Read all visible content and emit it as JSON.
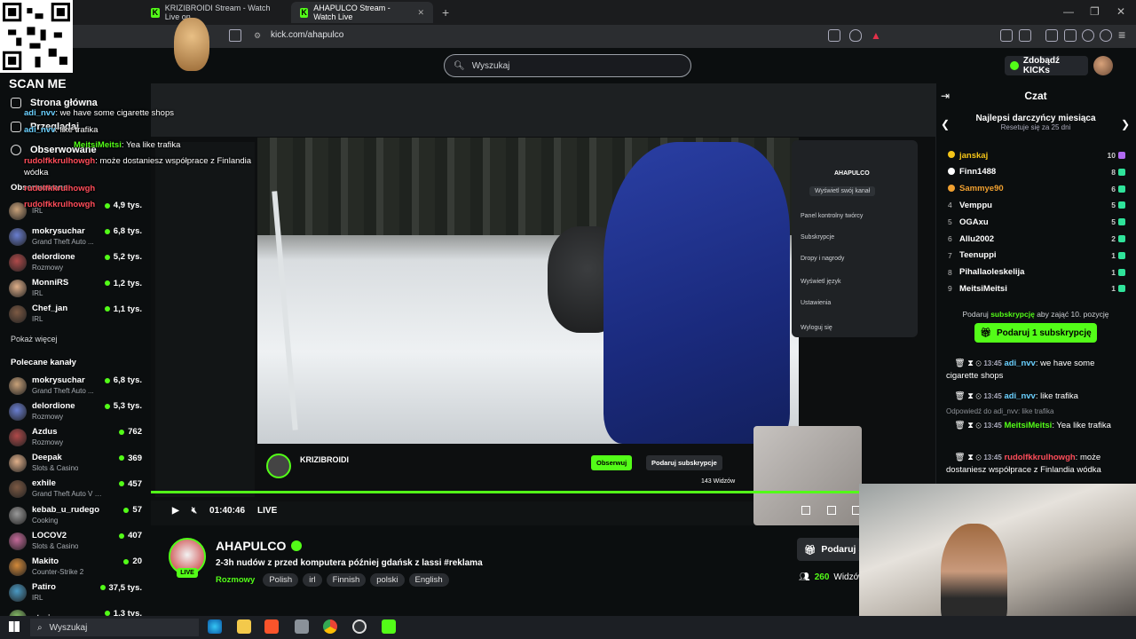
{
  "browser": {
    "tabs": [
      {
        "label": "KRIZIBROIDI Stream - Watch Live on",
        "active": false
      },
      {
        "label": "AHAPULCO Stream - Watch Live",
        "active": true
      }
    ],
    "url": "kick.com/ahapulco",
    "new_tab_symbol": "+"
  },
  "header": {
    "search_placeholder": "Wyszukaj",
    "kicks_button": "Zdobądź KICKs"
  },
  "overlay": {
    "scan_me": "SCAN ME",
    "chat_lines": [
      {
        "user": "adi_nvv",
        "text": "we have some cigarette shops"
      },
      {
        "user": "adi_nvv",
        "text": "like trafika"
      },
      {
        "user": "MeitsiMeitsi",
        "text": "Yea like trafika"
      },
      {
        "user": "rudolfkkrulhowgh",
        "text": "może dostaniesz współprace z Finlandia"
      },
      {
        "user": "",
        "text": "wódka"
      },
      {
        "user": "rudolfkkrulhowgh",
        "text": ""
      },
      {
        "user": "rudolfkkrulhowgh",
        "text": ""
      }
    ]
  },
  "sidebar": {
    "nav": [
      "Strona główna",
      "Przeglądaj",
      "Obserwowane"
    ],
    "followed_title": "Obserwowane",
    "followed": [
      {
        "name": "",
        "category": "IRL",
        "viewers": "4,9 tys."
      },
      {
        "name": "mokrysuchar",
        "category": "Grand Theft Auto ...",
        "viewers": "6,8 tys."
      },
      {
        "name": "delordione",
        "category": "Rozmowy",
        "viewers": "5,2 tys."
      },
      {
        "name": "MonniRS",
        "category": "IRL",
        "viewers": "1,2 tys."
      },
      {
        "name": "Chef_jan",
        "category": "IRL",
        "viewers": "1,1 tys."
      }
    ],
    "show_more": "Pokaż więcej",
    "recommended_title": "Polecane kanały",
    "recommended": [
      {
        "name": "mokrysuchar",
        "category": "Grand Theft Auto ...",
        "viewers": "6,8 tys."
      },
      {
        "name": "delordione",
        "category": "Rozmowy",
        "viewers": "5,3 tys."
      },
      {
        "name": "Azdus",
        "category": "Rozmowy",
        "viewers": "762"
      },
      {
        "name": "Deepak",
        "category": "Slots & Casino",
        "viewers": "369"
      },
      {
        "name": "exhile",
        "category": "Grand Theft Auto V (G...",
        "viewers": "457"
      },
      {
        "name": "kebab_u_rudego",
        "category": "Cooking",
        "viewers": "57"
      },
      {
        "name": "LOCOV2",
        "category": "Slots & Casino",
        "viewers": "407"
      },
      {
        "name": "Makito",
        "category": "Counter-Strike 2",
        "viewers": "20"
      },
      {
        "name": "Patiro",
        "category": "IRL",
        "viewers": "37,5 tys."
      },
      {
        "name": "strojny",
        "category": "",
        "viewers": "1,3 tys."
      }
    ]
  },
  "player": {
    "elapsed": "01:40:46",
    "live": "LIVE",
    "nested_channel": "KRIZIBROIDI",
    "nested_follow": "Obserwuj",
    "nested_sub": "Podaruj subskrypcje",
    "nested_viewers": "143 Widzów",
    "nested_menu_name": "AHAPULCO",
    "nested_menu": [
      "Wyświetl swój kanał",
      "Panel kontrolny twórcy",
      "Subskrypcje",
      "Dropy i nagrody",
      "Wyświetl język",
      "Ustawienia",
      "Wyloguj się"
    ]
  },
  "stream": {
    "channel": "AHAPULCO",
    "title": "2-3h nudów z przed komputera później gdańsk z lassi #reklama",
    "category": "Rozmowy",
    "tags": [
      "Polish",
      "irl",
      "Finnish",
      "polski",
      "English"
    ],
    "live_badge": "LIVE",
    "sub_button": "Podaruj s",
    "viewers_count": "260",
    "viewers_label": "Widzów"
  },
  "chat": {
    "title": "Czat",
    "top_title": "Najlepsi darczyńcy miesiąca",
    "top_sub": "Resetuje się za 25 dni",
    "leaderboard": [
      {
        "rank": "",
        "name": "janskaj",
        "count": "10",
        "color": "#f5c518"
      },
      {
        "rank": "",
        "name": "Finn1488",
        "count": "8",
        "color": "#ffffff"
      },
      {
        "rank": "",
        "name": "Sammye90",
        "count": "6",
        "color": "#f0a030"
      },
      {
        "rank": "4",
        "name": "Vemppu",
        "count": "5",
        "color": "#ffffff"
      },
      {
        "rank": "5",
        "name": "OGAxu",
        "count": "5",
        "color": "#ffffff"
      },
      {
        "rank": "6",
        "name": "Allu2002",
        "count": "2",
        "color": "#ffffff"
      },
      {
        "rank": "7",
        "name": "Teenuppi",
        "count": "1",
        "color": "#ffffff"
      },
      {
        "rank": "8",
        "name": "Pihallaoleskelija",
        "count": "1",
        "color": "#ffffff"
      },
      {
        "rank": "9",
        "name": "MeitsiMeitsi",
        "count": "1",
        "color": "#ffffff"
      }
    ],
    "gift_cta_pre": "Podaruj",
    "gift_cta_link": "subskrypcję",
    "gift_cta_post": "aby zająć 10. pozycję",
    "gift_button": "Podaruj 1 subskrypcję",
    "messages": [
      {
        "time": "13:45",
        "user": "adi_nvv",
        "user_color": "#6ad0ff",
        "text": "we have some cigarette shops"
      },
      {
        "time": "13:45",
        "user": "adi_nvv",
        "user_color": "#6ad0ff",
        "text": "like trafika"
      },
      {
        "reply": "Odpowiedź do adi_nvv: like trafika",
        "time": "13:45",
        "user": "MeitsiMeitsi",
        "user_color": "#53fc18",
        "text": "Yea like trafika"
      },
      {
        "time": "13:45",
        "user": "rudolfkkrulhowgh",
        "user_color": "#ff4d5a",
        "text": "może dostaniesz współprace z Finlandia wódka"
      }
    ]
  },
  "taskbar": {
    "search": "Wyszukaj"
  }
}
